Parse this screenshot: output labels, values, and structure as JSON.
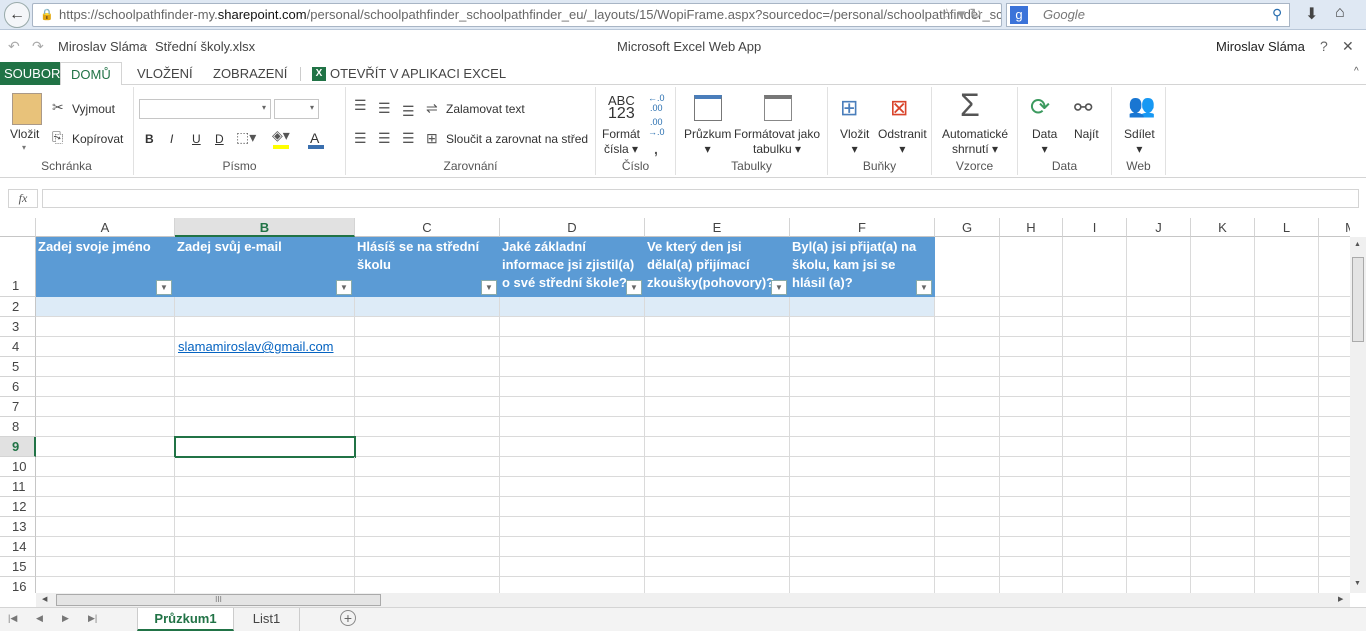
{
  "browser": {
    "url_prefix": "https://schoolpathfinder-my.",
    "url_domain": "sharepoint.com",
    "url_rest": "/personal/schoolpathfinder_schoolpathfinder_eu/_layouts/15/WopiFrame.aspx?sourcedoc=/personal/schoolpathfinder_sc",
    "search_placeholder": "Google"
  },
  "app": {
    "breadcrumb_user": "Miroslav Sláma",
    "file_name": "Střední školy.xlsx",
    "title": "Microsoft Excel Web App",
    "user": "Miroslav Sláma",
    "help": "?",
    "close": "✕"
  },
  "tabs": [
    {
      "label": "SOUBOR"
    },
    {
      "label": "DOMŮ"
    },
    {
      "label": "VLOŽENÍ"
    },
    {
      "label": "ZOBRAZENÍ"
    },
    {
      "label": "OTEVŘÍT V APLIKACI EXCEL"
    }
  ],
  "ribbon": {
    "clipboard": {
      "label": "Schránka",
      "paste": "Vložit",
      "cut": "Vyjmout",
      "copy": "Kopírovat"
    },
    "font": {
      "label": "Písmo",
      "bold": "B",
      "italic": "I",
      "underline": "U",
      "double_underline": "D",
      "font_color": "A"
    },
    "alignment": {
      "label": "Zarovnání",
      "wrap": "Zalamovat text",
      "merge": "Sloučit a zarovnat na střed"
    },
    "number": {
      "label": "Číslo",
      "format_line1": "Formát",
      "format_line2": "čísla",
      "abc": "ABC",
      "n123": "123"
    },
    "tables": {
      "label": "Tabulky",
      "survey": "Průzkum",
      "format_line1": "Formátovat jako",
      "format_line2": "tabulku"
    },
    "cells": {
      "label": "Buňky",
      "insert": "Vložit",
      "delete": "Odstranit"
    },
    "formulas": {
      "label": "Vzorce",
      "autosum_line1": "Automatické",
      "autosum_line2": "shrnutí"
    },
    "data": {
      "label": "Data",
      "data": "Data",
      "find": "Najít"
    },
    "web": {
      "label": "Web",
      "share": "Sdílet"
    }
  },
  "formula_bar": {
    "fx": "fx",
    "value": ""
  },
  "grid": {
    "columns": [
      "A",
      "B",
      "C",
      "D",
      "E",
      "F",
      "G",
      "H",
      "I",
      "J",
      "K",
      "L",
      "M"
    ],
    "selected_column": "B",
    "selected_row": 9,
    "rows": [
      "1",
      "2",
      "3",
      "4",
      "5",
      "6",
      "7",
      "8",
      "9",
      "10",
      "11",
      "12",
      "13",
      "14",
      "15",
      "16"
    ],
    "headers": [
      "Zadej svoje jméno",
      "Zadej svůj e-mail",
      "Hlásíš se na střední školu",
      "Jaké základní informace jsi zjistil(a) o své střední škole?",
      "Ve který den jsi dělal(a) přijímací zkoušky(pohovory)?",
      "Byl(a) jsi přijat(a) na školu, kam jsi se hlásil (a)?"
    ],
    "email_cell": "slamamiroslav@gmail.com"
  },
  "sheets": [
    {
      "label": "Průzkum1",
      "active": true
    },
    {
      "label": "List1",
      "active": false
    }
  ],
  "colors": {
    "accent": "#217346",
    "table_header": "#5b9bd5",
    "band": "#ddebf7",
    "link": "#0563c1"
  }
}
